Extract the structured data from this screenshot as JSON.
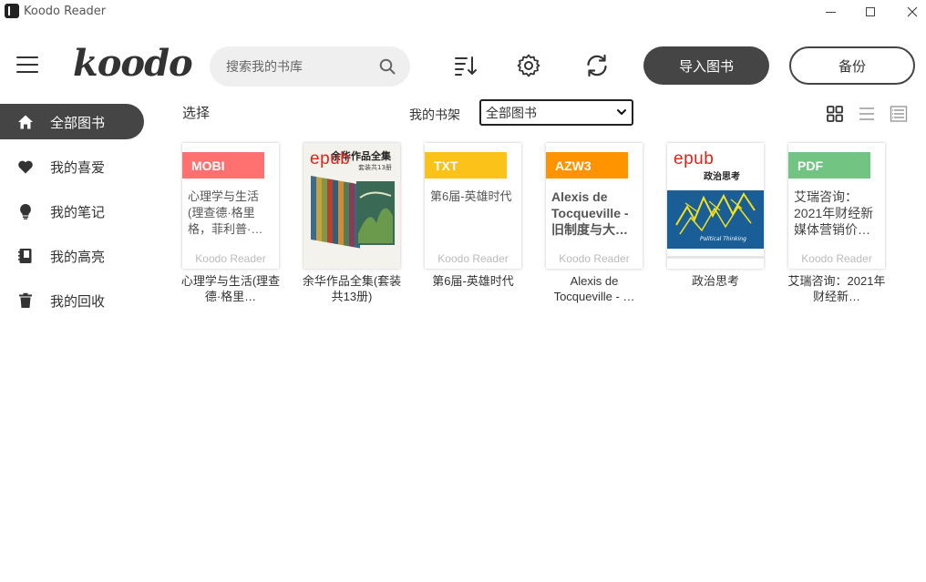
{
  "window": {
    "title": "Koodo Reader"
  },
  "header": {
    "logo": "koodo",
    "search_placeholder": "搜索我的书库",
    "import_label": "导入图书",
    "backup_label": "备份"
  },
  "sidebar": {
    "items": [
      {
        "label": "全部图书",
        "icon": "home-icon",
        "active": true
      },
      {
        "label": "我的喜爱",
        "icon": "heart-icon"
      },
      {
        "label": "我的笔记",
        "icon": "lightbulb-icon"
      },
      {
        "label": "我的高亮",
        "icon": "notebook-icon"
      },
      {
        "label": "我的回收",
        "icon": "trash-icon"
      }
    ]
  },
  "toolbar": {
    "select_label": "选择",
    "shelf_label": "我的书架",
    "shelf_selected": "全部图书"
  },
  "books": [
    {
      "format": "MOBI",
      "format_color": "#ff7171",
      "cover_title": "心理学与生活(理查德·格里格，菲利普·…",
      "cover_author": "Koodo Reader",
      "title": "心理学与生活(理查德·格里…"
    },
    {
      "format": "epub",
      "cover_image": true,
      "cover_text_top": "余华作品全集",
      "cover_text_sub": "套装共13册",
      "title": "余华作品全集(套装共13册)"
    },
    {
      "format": "TXT",
      "format_color": "#fbc21a",
      "cover_title": "第6届-英雄时代",
      "cover_author": "Koodo Reader",
      "title": "第6届-英雄时代"
    },
    {
      "format": "AZW3",
      "format_color": "#ff9400",
      "cover_title": "Alexis de Tocqueville - 旧制度与大…",
      "cover_author": "Koodo Reader",
      "title": "Alexis de Tocqueville - …"
    },
    {
      "format": "epub",
      "cover_image": true,
      "cover_text_top": "政治思考",
      "cover_text_sub": "Political Thinking",
      "title": "政治思考"
    },
    {
      "format": "PDF",
      "format_color": "#72c482",
      "cover_title": "艾瑞咨询：2021年财经新媒体营销价…",
      "cover_author": "Koodo Reader",
      "title": "艾瑞咨询：2021年财经新…"
    }
  ],
  "colors": {
    "accent": "#454545"
  }
}
